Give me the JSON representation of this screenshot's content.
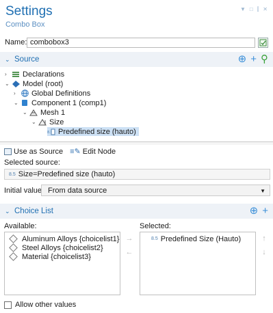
{
  "header": {
    "title": "Settings",
    "subtitle": "Combo Box"
  },
  "name": {
    "label": "Name:",
    "value": "combobox3"
  },
  "source_section": {
    "title": "Source",
    "tree": [
      {
        "label": "Declarations",
        "icon": "declarations-icon"
      },
      {
        "label": "Model (root)",
        "icon": "model-icon"
      },
      {
        "label": "Global Definitions",
        "icon": "globe-icon"
      },
      {
        "label": "Component 1 (comp1)",
        "icon": "component-icon"
      },
      {
        "label": "Mesh 1",
        "icon": "mesh-icon"
      },
      {
        "label": "Size",
        "icon": "size-icon"
      },
      {
        "label": "Predefined size (hauto)",
        "icon": "predefined-size-icon"
      }
    ],
    "use_as_source": "Use as Source",
    "edit_node": "Edit Node",
    "selected_source_label": "Selected source:",
    "selected_source_value": "Size=Predefined size (hauto)",
    "initial_value_label": "Initial value:",
    "initial_value": "From data source"
  },
  "choice_list": {
    "title": "Choice List",
    "available_label": "Available:",
    "selected_label": "Selected:",
    "available": [
      "Aluminum Alloys {choicelist1}",
      "Steel Alloys {choicelist2}",
      "Material {choicelist3}"
    ],
    "selected": [
      "Predefined Size (Hauto)"
    ],
    "allow_other_label": "Allow other values"
  },
  "colors": {
    "accent": "#1f6fb2",
    "selection": "#cde1f5",
    "section_bg": "#eef2f7"
  }
}
